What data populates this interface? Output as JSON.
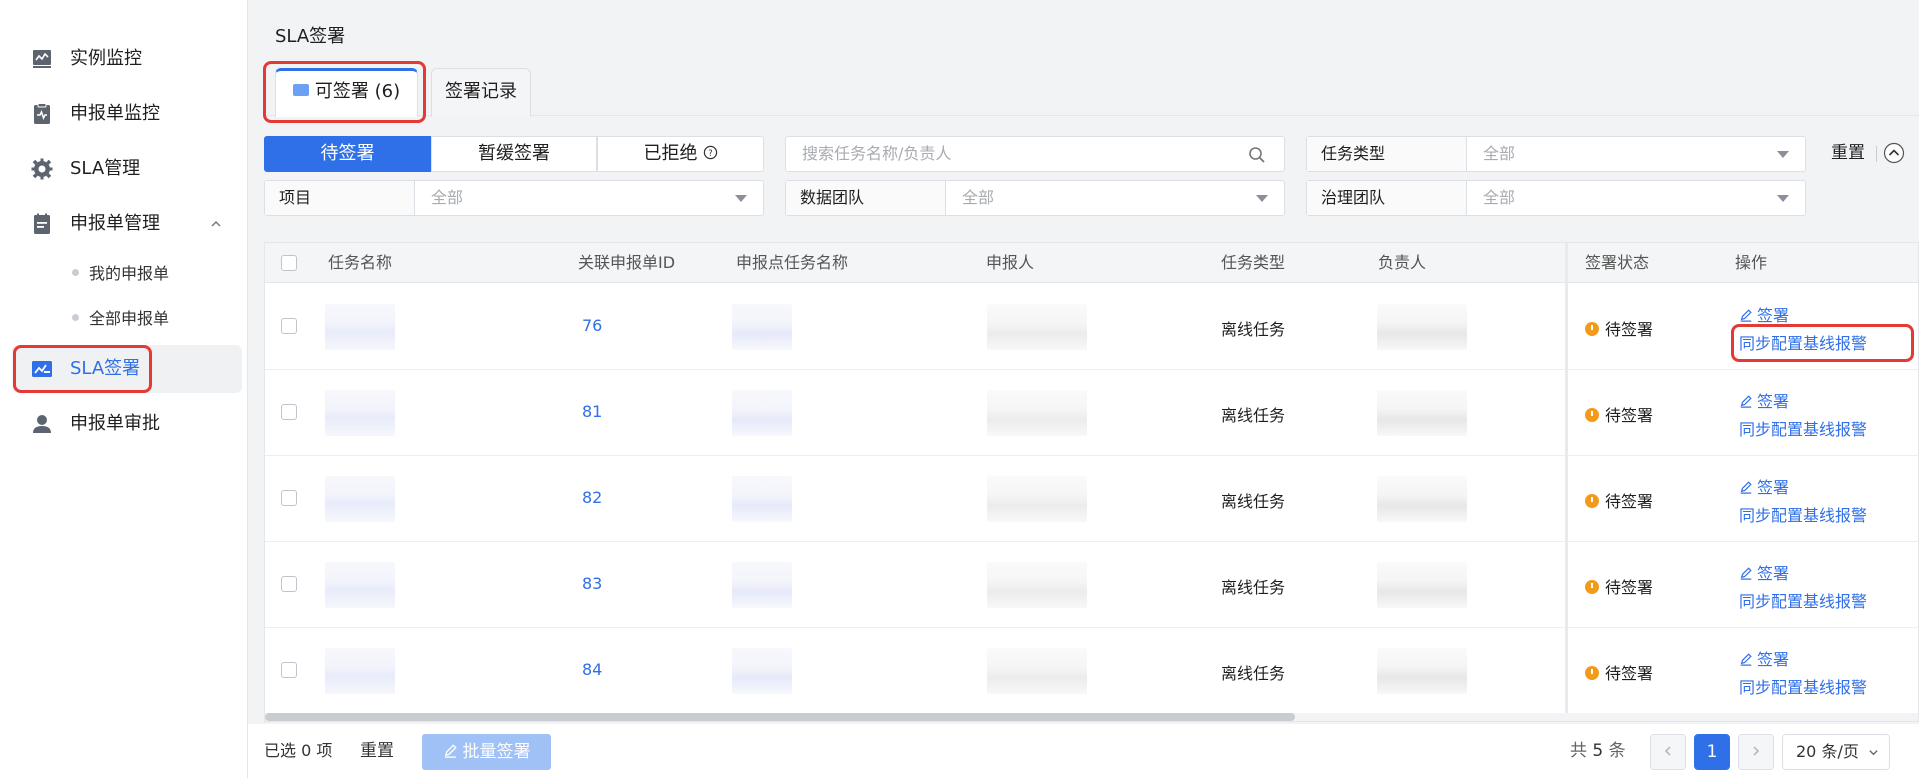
{
  "sidebar": {
    "items": [
      {
        "label": "实例监控",
        "icon": "monitor-chart-icon"
      },
      {
        "label": "申报单监控",
        "icon": "clipboard-pulse-icon"
      },
      {
        "label": "SLA管理",
        "icon": "gear-icon"
      },
      {
        "label": "申报单管理",
        "icon": "document-list-icon"
      },
      {
        "label": "SLA签署",
        "icon": "sign-chart-icon",
        "active": true
      },
      {
        "label": "申报单审批",
        "icon": "user-icon"
      }
    ],
    "subitems": [
      "我的申报单",
      "全部申报单"
    ]
  },
  "page": {
    "title": "SLA签署"
  },
  "tabs": [
    {
      "label": "可签署 (6)",
      "active": true
    },
    {
      "label": "签署记录"
    }
  ],
  "segments": [
    "待签署",
    "暂缓签署",
    "已拒绝"
  ],
  "search": {
    "placeholder": "搜索任务名称/负责人"
  },
  "filters": {
    "task_type": {
      "label": "任务类型",
      "value": "全部"
    },
    "project": {
      "label": "项目",
      "value": "全部"
    },
    "data_team": {
      "label": "数据团队",
      "value": "全部"
    },
    "gov_team": {
      "label": "治理团队",
      "value": "全部"
    },
    "reset": "重置"
  },
  "table": {
    "columns": [
      "任务名称",
      "关联申报单ID",
      "申报点任务名称",
      "申报人",
      "任务类型",
      "负责人",
      "签署状态",
      "操作"
    ],
    "rows": [
      {
        "id": "76",
        "type": "离线任务",
        "status": "待签署",
        "action_sign": "签署",
        "action_sync": "同步配置基线报警"
      },
      {
        "id": "81",
        "type": "离线任务",
        "status": "待签署",
        "action_sign": "签署",
        "action_sync": "同步配置基线报警"
      },
      {
        "id": "82",
        "type": "离线任务",
        "status": "待签署",
        "action_sign": "签署",
        "action_sync": "同步配置基线报警"
      },
      {
        "id": "83",
        "type": "离线任务",
        "status": "待签署",
        "action_sign": "签署",
        "action_sync": "同步配置基线报警"
      },
      {
        "id": "84",
        "type": "离线任务",
        "status": "待签署",
        "action_sign": "签署",
        "action_sync": "同步配置基线报警"
      }
    ]
  },
  "footer": {
    "selected_prefix": "已选",
    "selected_count": "0",
    "selected_suffix": "项",
    "reset": "重置",
    "batch_sign": "批量签署",
    "total_prefix": "共",
    "total_count": "5",
    "total_suffix": "条",
    "page": "1",
    "page_size": "20 条/页"
  },
  "colors": {
    "accent": "#2f6fe8",
    "highlight": "#e53935",
    "pending": "#f29a1c"
  }
}
